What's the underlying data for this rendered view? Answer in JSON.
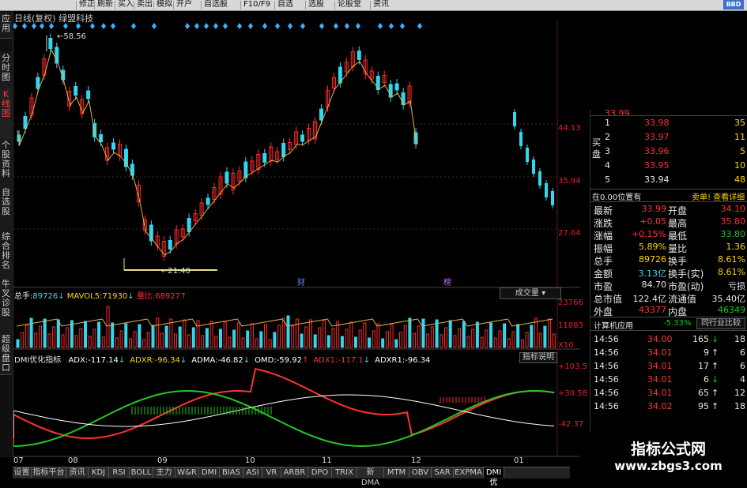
{
  "toolbar": {
    "items": [
      "修正",
      "刷新",
      "买入",
      "卖出",
      "模拟",
      "开户",
      "自选股",
      "F10/F9",
      "自选",
      "选股",
      "论股堂",
      "资讯"
    ],
    "logo": "BBD"
  },
  "left_tabs": [
    {
      "label": "应用",
      "active": false
    },
    {
      "label": "分时图",
      "active": false
    },
    {
      "label": "K线图",
      "active": true
    },
    {
      "label": "个股资料",
      "active": false
    },
    {
      "label": "自选股",
      "active": false
    },
    {
      "label": "综合排名",
      "active": false
    },
    {
      "label": "牛叉诊股",
      "active": false
    },
    {
      "label": "超级盘口",
      "active": false
    }
  ],
  "main_chart": {
    "title": "日线(复权)  绿盟科技",
    "high_label": "58.56",
    "low_label": "21.40",
    "price_axis": [
      "44.13",
      "35.94",
      "27.64"
    ],
    "event_markers": [
      "财",
      "榜"
    ],
    "colors": {
      "up": "#ff2a2a",
      "down": "#32d7ee",
      "ma": "#e8b04a",
      "ma2": "#ffffff",
      "diamond": "#3db2ff",
      "low_line": "#e8e090"
    }
  },
  "volume": {
    "header_label": "总手:",
    "header_value": "89726",
    "mavol_label": "MAVOL5:",
    "mavol_value": "71930",
    "ratio_label": "量比:",
    "ratio_value": "68927",
    "dropdown": "成交量",
    "axis": [
      "23766",
      "11883",
      "X10"
    ]
  },
  "dmi": {
    "name": "DMI优化指标",
    "values": [
      {
        "label": "ADX:",
        "value": "-117.14",
        "dir": "down",
        "color": "#ffffff"
      },
      {
        "label": "ADXR:",
        "value": "-96.34",
        "dir": "down",
        "color": "#ffd700"
      },
      {
        "label": "ADMA:",
        "value": "-46.82",
        "dir": "down",
        "color": "#ffffff"
      },
      {
        "label": "OMD:",
        "value": "-59.92",
        "dir": "up",
        "color": "#ffffff"
      },
      {
        "label": "ADX1:",
        "value": "-117.1",
        "dir": "down",
        "color": "#ff3232"
      },
      {
        "label": "ADXR1:",
        "value": "-96.34",
        "dir": "none",
        "color": "#ffffff"
      }
    ],
    "help_button": "指标说明",
    "axis": [
      "+103.5",
      "+30.58",
      "-42.37"
    ]
  },
  "date_axis": [
    "07",
    "08",
    "09",
    "10",
    "11",
    "12",
    "01"
  ],
  "bottom_tabs": [
    "设置",
    "指标平台",
    "资讯",
    "KDJ",
    "RSI",
    "BOLL",
    "主力",
    "W&R",
    "DMI",
    "BIAS",
    "ASI",
    "VR",
    "ARBR",
    "DPO",
    "TRIX",
    "新DMA",
    "MTM",
    "OBV",
    "SAR",
    "EXPMA",
    "DMI优"
  ],
  "order_book": {
    "buy_side_label": "买盘",
    "partial_top": "33.99",
    "rows": [
      {
        "level": "1",
        "price": "33.98",
        "vol": "35"
      },
      {
        "level": "2",
        "price": "33.97",
        "vol": "11"
      },
      {
        "level": "3",
        "price": "33.96",
        "vol": "5"
      },
      {
        "level": "4",
        "price": "33.95",
        "vol": "10"
      },
      {
        "level": "5",
        "price": "33.94",
        "vol": "48"
      }
    ]
  },
  "position_bar": {
    "left": "在0.00位置有",
    "right": "卖单!  查看详细"
  },
  "quote": [
    {
      "l": "最新",
      "lv": "33.99",
      "lc": "red",
      "r": "开盘",
      "rv": "34.10",
      "rc": "red"
    },
    {
      "l": "涨跌",
      "lv": "+0.05",
      "lc": "red",
      "r": "最高",
      "rv": "35.80",
      "rc": "red"
    },
    {
      "l": "涨幅",
      "lv": "+0.15%",
      "lc": "red",
      "r": "最低",
      "rv": "33.80",
      "rc": "grn"
    },
    {
      "l": "振幅",
      "lv": "5.89%",
      "lc": "yel",
      "r": "量比",
      "rv": "1.36",
      "rc": "yel"
    },
    {
      "l": "总手",
      "lv": "89726",
      "lc": "yel",
      "r": "换手",
      "rv": "8.61%",
      "rc": "yel"
    },
    {
      "l": "金额",
      "lv": "3.13亿",
      "lc": "cyan",
      "r": "换手(实)",
      "rv": "8.61%",
      "rc": "yel"
    },
    {
      "l": "市盈",
      "lv": "84.70",
      "lc": "wht",
      "r": "市盈(动)",
      "rv": "亏损",
      "rc": "wht"
    },
    {
      "l": "总市值",
      "lv": "122.4亿",
      "lc": "wht",
      "r": "流通值",
      "rv": "35.40亿",
      "rc": "wht"
    },
    {
      "l": "外盘",
      "lv": "43377",
      "lc": "red",
      "r": "内盘",
      "rv": "46349",
      "rc": "grn"
    }
  ],
  "industry": {
    "name": "计算机应用",
    "change": "-5.33%",
    "compare_button": "同行业比较"
  },
  "ticks": [
    {
      "time": "14:56",
      "price": "34.00",
      "vol": "165",
      "dir": "down",
      "n": "18"
    },
    {
      "time": "14:56",
      "price": "34.01",
      "vol": "9",
      "dir": "up",
      "n": "6"
    },
    {
      "time": "14:56",
      "price": "34.01",
      "vol": "17",
      "dir": "up",
      "n": "6"
    },
    {
      "time": "14:56",
      "price": "34.01",
      "vol": "6",
      "dir": "down",
      "n": "4"
    },
    {
      "time": "14:56",
      "price": "34.01",
      "vol": "65",
      "dir": "up",
      "n": "12"
    },
    {
      "time": "14:56",
      "price": "34.02",
      "vol": "95",
      "dir": "up",
      "n": "18"
    }
  ],
  "watermark": {
    "line1": "指标公式网",
    "line2": "www.zbgs3.com"
  }
}
